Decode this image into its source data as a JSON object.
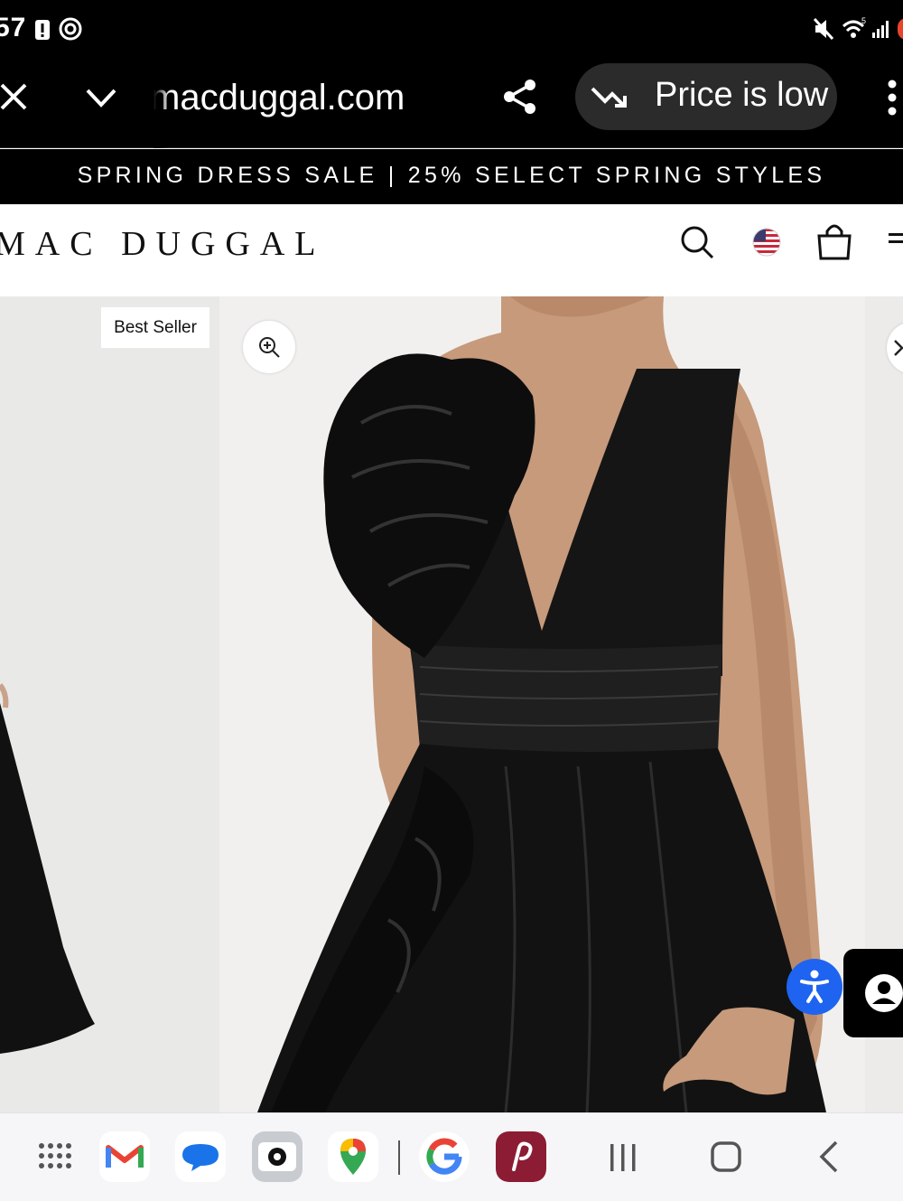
{
  "status_bar": {
    "time": "57",
    "icons": [
      "alert-icon",
      "threads-icon",
      "mute-icon",
      "wifi-icon",
      "signal-icon"
    ]
  },
  "browser": {
    "url": "macduggal.com",
    "price_chip": "Price is low",
    "icons": [
      "close-icon",
      "chevron-down-icon",
      "share-icon",
      "trend-down-icon",
      "more-vert-icon"
    ]
  },
  "promo": {
    "text": "SPRING DRESS SALE | 25% SELECT SPRING STYLES"
  },
  "site_header": {
    "logo": "MAC DUGGAL",
    "icons": [
      "search-icon",
      "us-flag-icon",
      "shopping-bag-icon",
      "menu-icon"
    ]
  },
  "gallery": {
    "badge": "Best Seller",
    "buttons": [
      "zoom-in-icon",
      "next-arrow-icon",
      "accessibility-icon",
      "chat-icon"
    ]
  },
  "taskbar": {
    "apps": [
      "apps-grid-icon",
      "gmail-icon",
      "messages-icon",
      "camera-icon",
      "maps-icon",
      "google-icon",
      "app-icon"
    ],
    "nav": [
      "recents-icon",
      "home-icon",
      "back-icon"
    ]
  },
  "colors": {
    "accent_blue": "#1e64f0",
    "bar_black": "#000000",
    "app_red": "#8c1c34"
  }
}
